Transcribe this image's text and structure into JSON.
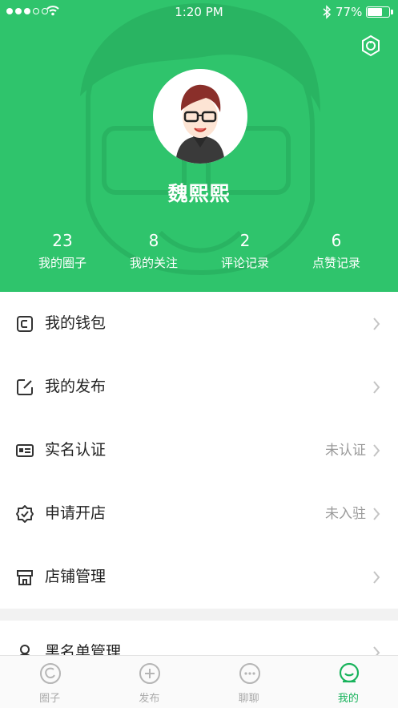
{
  "status_bar": {
    "time": "1:20 PM",
    "battery": "77%",
    "battery_level": 0.77
  },
  "profile": {
    "name": "魏熙熙",
    "stats": [
      {
        "value": "23",
        "label": "我的圈子"
      },
      {
        "value": "8",
        "label": "我的关注"
      },
      {
        "value": "2",
        "label": "评论记录"
      },
      {
        "value": "6",
        "label": "点赞记录"
      }
    ]
  },
  "menu": [
    {
      "label": "我的钱包",
      "value": "",
      "icon": "wallet-icon"
    },
    {
      "label": "我的发布",
      "value": "",
      "icon": "edit-icon"
    },
    {
      "label": "实名认证",
      "value": "未认证",
      "icon": "id-card-icon"
    },
    {
      "label": "申请开店",
      "value": "未入驻",
      "icon": "badge-check-icon"
    },
    {
      "label": "店铺管理",
      "value": "",
      "icon": "shop-icon"
    }
  ],
  "menu2": [
    {
      "label": "黑名单管理",
      "icon": "user-icon"
    }
  ],
  "tabs": [
    {
      "label": "圈子",
      "icon": "circle-icon"
    },
    {
      "label": "发布",
      "icon": "plus-icon"
    },
    {
      "label": "聊聊",
      "icon": "chat-icon"
    },
    {
      "label": "我的",
      "icon": "profile-icon"
    }
  ],
  "colors": {
    "brand": "#2fc46c",
    "tab_active": "#19b35c",
    "text": "#222222",
    "muted": "#9a9a9a"
  }
}
